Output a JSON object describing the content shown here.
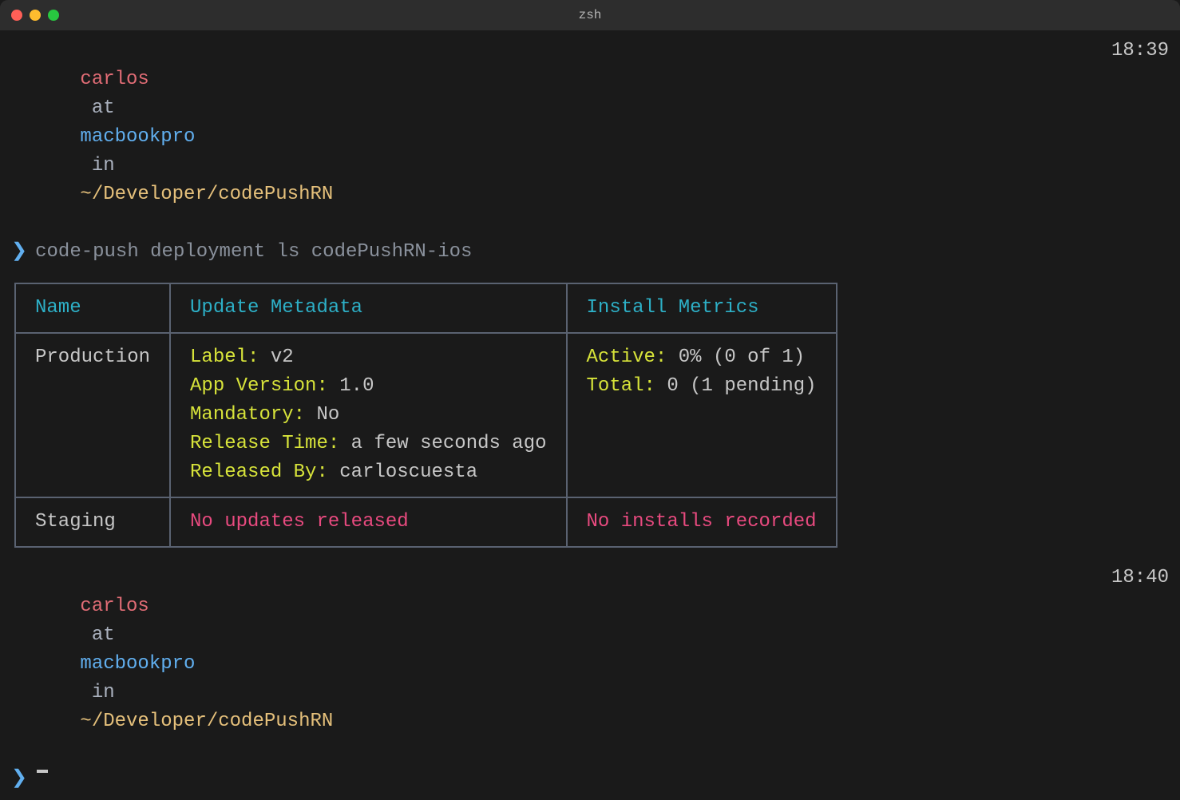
{
  "window": {
    "title": "zsh"
  },
  "prompts": [
    {
      "user": "carlos",
      "at": "at",
      "host": "macbookpro",
      "in": "in",
      "path": "~/Developer/codePushRN",
      "time": "18:39",
      "command": "code-push deployment ls codePushRN-ios"
    },
    {
      "user": "carlos",
      "at": "at",
      "host": "macbookpro",
      "in": "in",
      "path": "~/Developer/codePushRN",
      "time": "18:40",
      "command": ""
    }
  ],
  "table": {
    "headers": {
      "name": "Name",
      "update": "Update Metadata",
      "install": "Install Metrics"
    },
    "rows": [
      {
        "name": "Production",
        "update": [
          {
            "key": "Label:",
            "val": " v2"
          },
          {
            "key": "App Version:",
            "val": " 1.0"
          },
          {
            "key": "Mandatory:",
            "val": " No"
          },
          {
            "key": "Release Time:",
            "val": " a few seconds ago"
          },
          {
            "key": "Released By:",
            "val": " carloscuesta"
          }
        ],
        "install": [
          {
            "key": "Active:",
            "val": " 0% (0 of 1)"
          },
          {
            "key": "Total:",
            "val": " 0 (1 pending)"
          }
        ]
      },
      {
        "name": "Staging",
        "update_empty": "No updates released",
        "install_empty": "No installs recorded"
      }
    ]
  }
}
